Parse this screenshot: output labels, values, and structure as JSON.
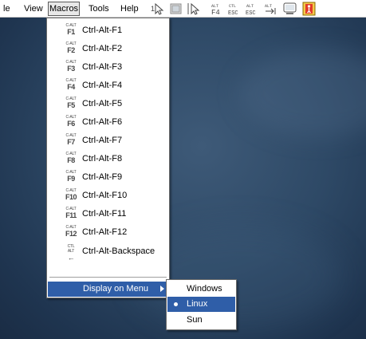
{
  "menubar": {
    "items": [
      "le",
      "View",
      "Macros",
      "Tools",
      "Help"
    ],
    "active": "Macros"
  },
  "toolbar": {
    "icons": [
      {
        "name": "one-to-one-cursor-icon"
      },
      {
        "name": "screen-capture-icon"
      },
      {
        "name": "cursor-toggle-icon"
      },
      {
        "name": "alt-f4-icon",
        "top": "ALT",
        "bottom": "F4"
      },
      {
        "name": "ctl-esc-icon",
        "top": "CTL",
        "bottom": "ESC"
      },
      {
        "name": "alt-esc-icon",
        "top": "ALT",
        "bottom": "ESC"
      },
      {
        "name": "alt-tab-icon",
        "top": "ALT",
        "bottom": "⇥"
      },
      {
        "name": "monitor-icon"
      },
      {
        "name": "exit-icon"
      }
    ]
  },
  "macros_menu": {
    "items": [
      {
        "label": "Ctrl-Alt-F1",
        "icon_top": "C-ALT",
        "icon_key": "F1"
      },
      {
        "label": "Ctrl-Alt-F2",
        "icon_top": "C-ALT",
        "icon_key": "F2"
      },
      {
        "label": "Ctrl-Alt-F3",
        "icon_top": "C-ALT",
        "icon_key": "F3"
      },
      {
        "label": "Ctrl-Alt-F4",
        "icon_top": "C-ALT",
        "icon_key": "F4"
      },
      {
        "label": "Ctrl-Alt-F5",
        "icon_top": "C-ALT",
        "icon_key": "F5"
      },
      {
        "label": "Ctrl-Alt-F6",
        "icon_top": "C-ALT",
        "icon_key": "F6"
      },
      {
        "label": "Ctrl-Alt-F7",
        "icon_top": "C-ALT",
        "icon_key": "F7"
      },
      {
        "label": "Ctrl-Alt-F8",
        "icon_top": "C-ALT",
        "icon_key": "F8"
      },
      {
        "label": "Ctrl-Alt-F9",
        "icon_top": "C-ALT",
        "icon_key": "F9"
      },
      {
        "label": "Ctrl-Alt-F10",
        "icon_top": "C-ALT",
        "icon_key": "F10"
      },
      {
        "label": "Ctrl-Alt-F11",
        "icon_top": "C-ALT",
        "icon_key": "F11"
      },
      {
        "label": "Ctrl-Alt-F12",
        "icon_top": "C-ALT",
        "icon_key": "F12"
      },
      {
        "label": "Ctrl-Alt-Backspace",
        "icon_top": "CTL ALT",
        "icon_key": "←"
      }
    ],
    "display_on_menu": "Display on Menu"
  },
  "display_submenu": {
    "items": [
      "Windows",
      "Linux",
      "Sun"
    ],
    "selected": "Linux"
  },
  "colors": {
    "highlight": "#2f5ea8",
    "desktop": "#2e4966"
  }
}
